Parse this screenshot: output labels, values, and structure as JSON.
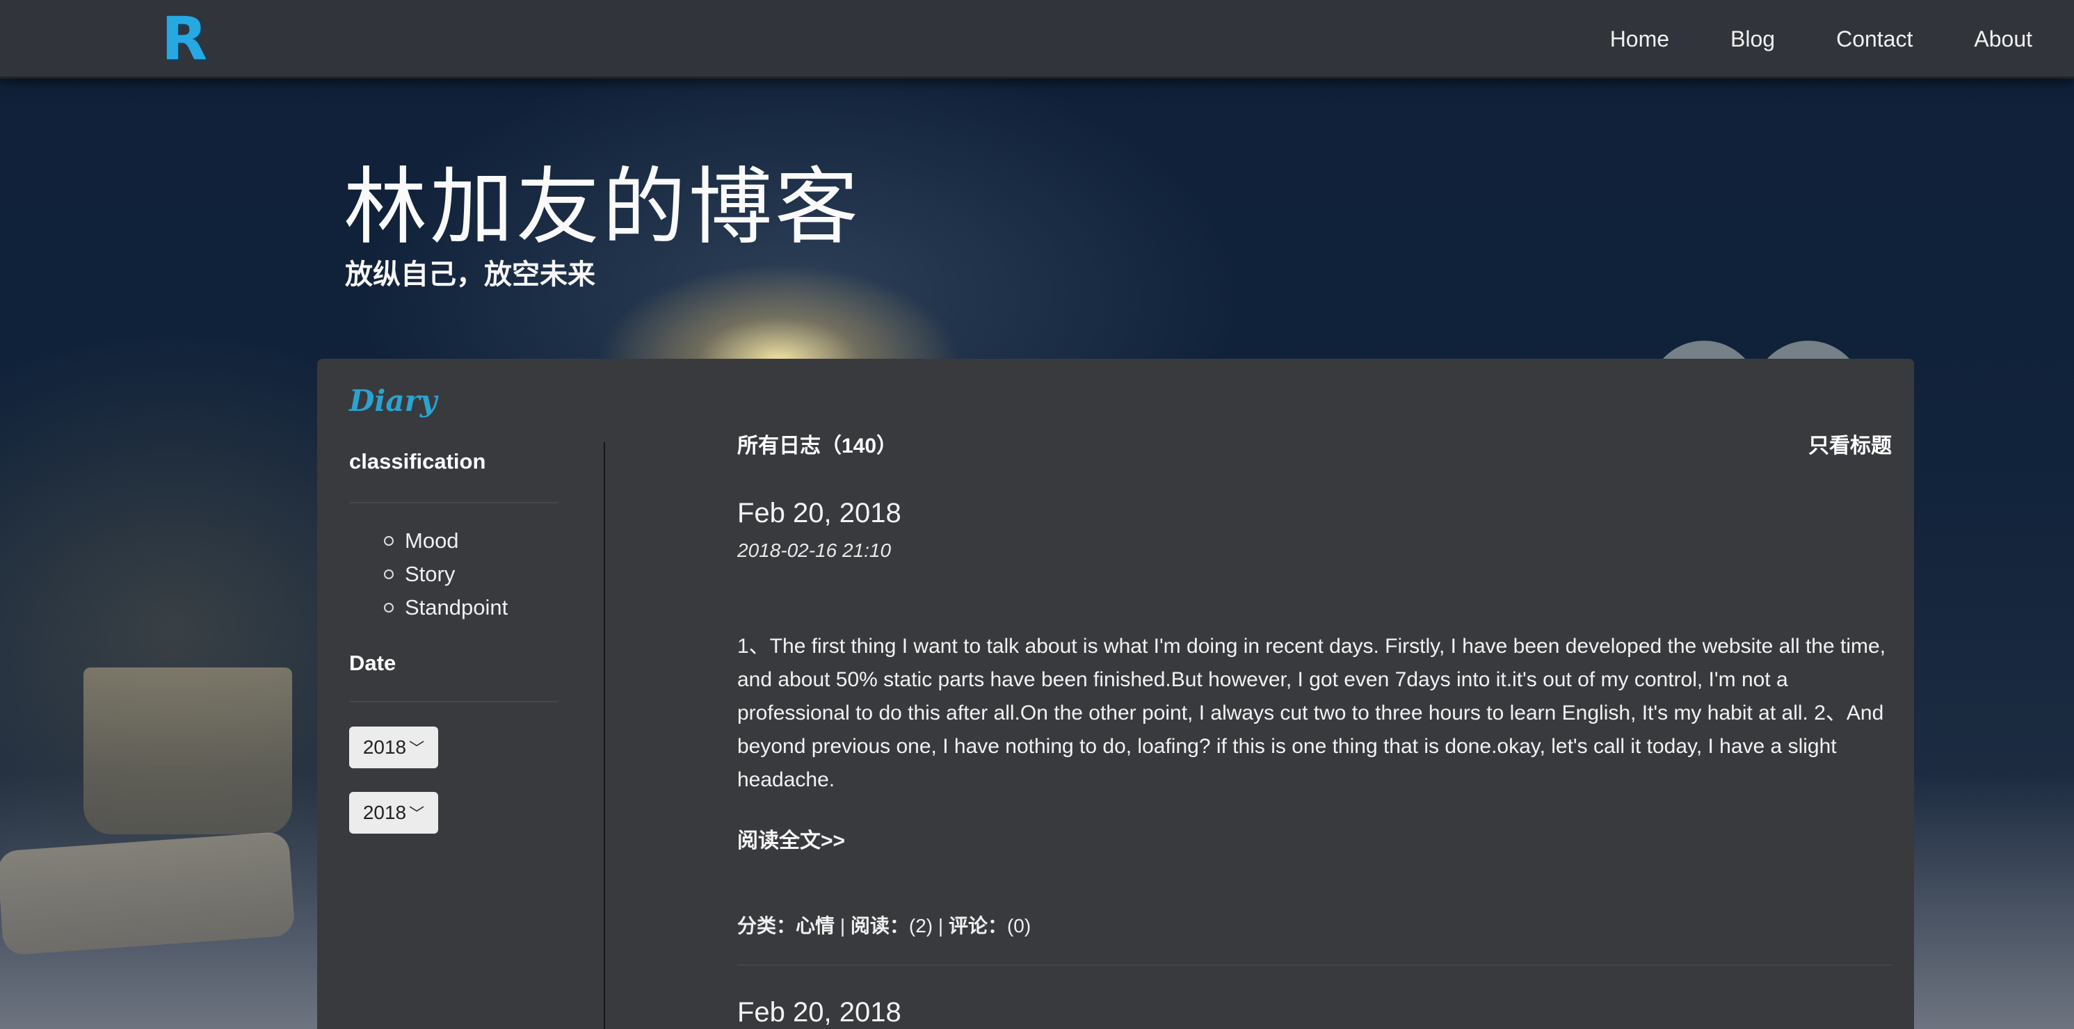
{
  "nav": {
    "logo": "R",
    "links": [
      "Home",
      "Blog",
      "Contact",
      "About"
    ]
  },
  "hero": {
    "title": "林加友的博客",
    "subtitle": "放纵自己，放空未来"
  },
  "sidebar": {
    "brand": "Diary",
    "classification_heading": "classification",
    "categories": [
      "Mood",
      "Story",
      "Standpoint"
    ],
    "date_heading": "Date",
    "year_selects": [
      "2018",
      "2018"
    ]
  },
  "content": {
    "all_posts_label": "所有日志（140）",
    "title_only_toggle": "只看标题",
    "posts": [
      {
        "title": "Feb 20, 2018",
        "time": "2018-02-16 21:10",
        "body": "1、The first thing I want to talk about is what I'm doing in recent days. Firstly, I have been developed the website all the time, and about 50% static parts have been finished.But however, I got even 7days into it.it's out of my control, I'm not a professional to do this after all.On the other point, I always cut two to three hours to learn English, It's my habit at all. 2、And beyond previous one, I have nothing to do, loafing? if this is one thing that is done.okay, let's call it today, I have a slight headache.",
        "read_more": "阅读全文>>",
        "meta": {
          "category_label": "分类：",
          "category": "心情",
          "reads_label": "阅读：",
          "reads": "(2)",
          "comments_label": "评论：",
          "comments": "(0)"
        }
      },
      {
        "title": "Feb 20, 2018"
      }
    ]
  },
  "colors": {
    "navbar": "#31353b",
    "panel": "#393a3e",
    "accent": "#2aa3cf"
  }
}
